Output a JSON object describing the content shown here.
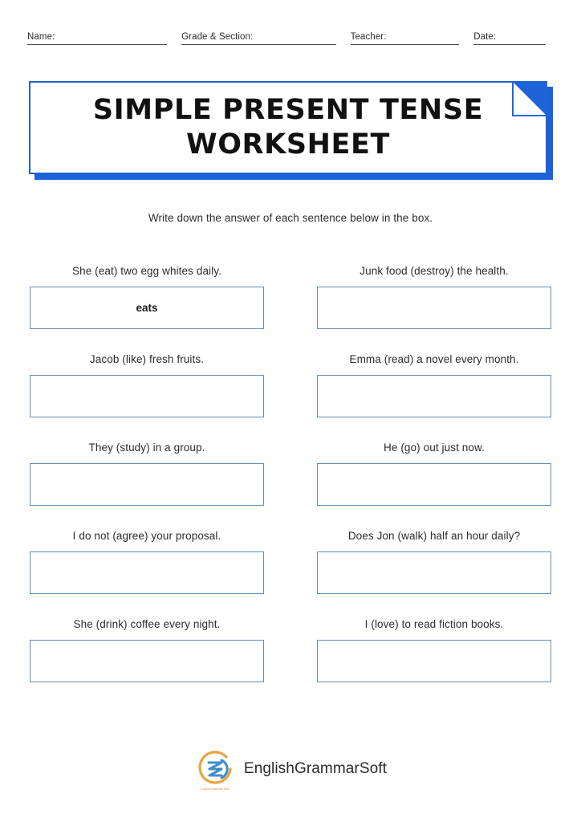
{
  "header": {
    "fields": [
      {
        "label": "Name:",
        "value": ""
      },
      {
        "label": "Grade & Section:",
        "value": ""
      },
      {
        "label": "Teacher:",
        "value": ""
      },
      {
        "label": "Date:",
        "value": ""
      }
    ]
  },
  "title": {
    "line1": "SIMPLE PRESENT TENSE",
    "line2": "WORKSHEET",
    "border_color": "#1f63d8",
    "shadow_color": "#1a62d6"
  },
  "instruction": "Write down the answer of each sentence below in the box.",
  "questions": {
    "box_border_color": "#5f8fba",
    "rows": [
      {
        "left": {
          "prompt": "She (eat) two egg whites daily.",
          "answer": "eats"
        },
        "right": {
          "prompt": "Junk food (destroy) the health.",
          "answer": ""
        }
      },
      {
        "left": {
          "prompt": "Jacob (like) fresh fruits.",
          "answer": ""
        },
        "right": {
          "prompt": "Emma (read) a novel every month.",
          "answer": ""
        }
      },
      {
        "left": {
          "prompt": "They (study) in a group.",
          "answer": ""
        },
        "right": {
          "prompt": "He (go) out just now.",
          "answer": ""
        }
      },
      {
        "left": {
          "prompt": "I do not (agree) your proposal.",
          "answer": ""
        },
        "right": {
          "prompt": "Does Jon (walk) half an hour daily?",
          "answer": ""
        }
      },
      {
        "left": {
          "prompt": "She (drink) coffee every night.",
          "answer": ""
        },
        "right": {
          "prompt": "I (love) to read fiction books.",
          "answer": ""
        }
      }
    ]
  },
  "footer": {
    "brand": "EnglishGrammarSoft",
    "logo_caption": "EnglishGrammarSoft",
    "logo_ring_color": "#e8a33d",
    "logo_swirl_color": "#3c8fc4"
  }
}
